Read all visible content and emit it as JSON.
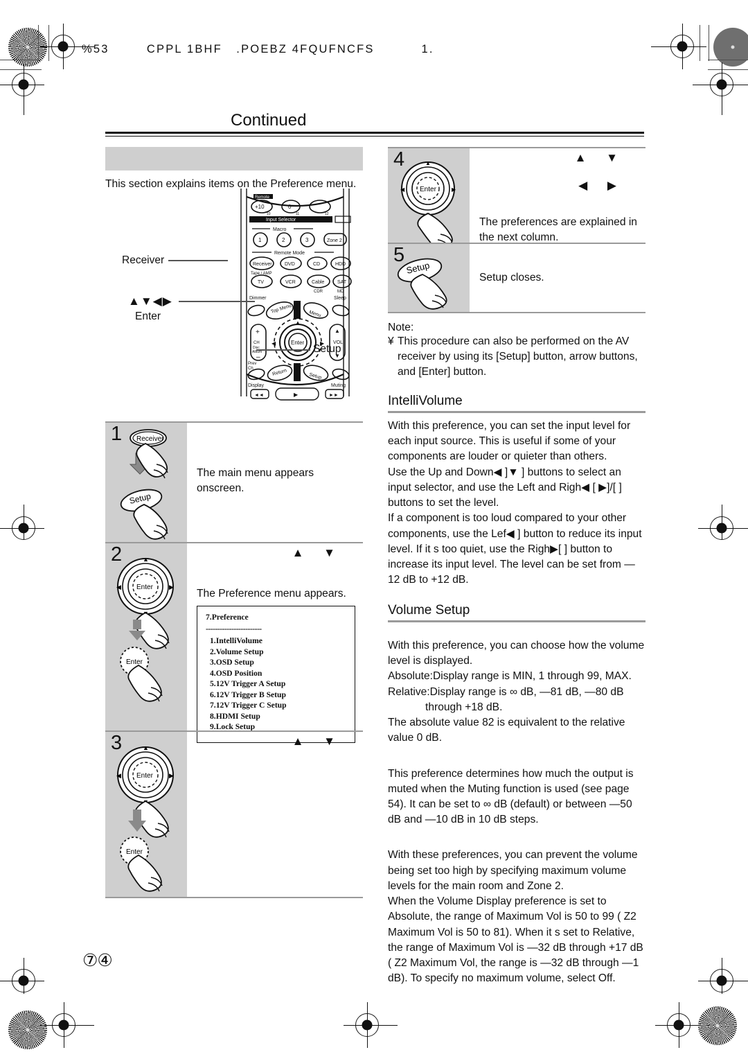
{
  "print_marks": {
    "header_slug": "%53        CPPL 1BHF   .POEBZ 4FQUFNCFS          1."
  },
  "page": {
    "title": "Continued",
    "page_number": "⑦④"
  },
  "left_column": {
    "section_heading_bar": "",
    "intro": "This section explains items on the  Preference  menu.",
    "remote_callouts": {
      "receiver": "Receiver",
      "arrows_glyph": "▲▼◀▶",
      "enter": "Enter",
      "setup": "Setup"
    },
    "remote_buttons": {
      "plus10": "+10",
      "zero": "0",
      "input_selector": "Input Selector",
      "macro": "Macro",
      "macro1": "1",
      "macro2": "2",
      "macro3": "3",
      "zone2": "Zone 2",
      "remote_mode": "Remote Mode",
      "receiver": "Receiver",
      "tape_amp": "Tape / AMP",
      "dvd": "DVD",
      "cd": "CD",
      "hdd": "HDD",
      "tv": "TV",
      "vcr": "VCR",
      "cable": "Cable",
      "cdr": "CDR",
      "sat": "SAT",
      "md": "MD",
      "dimmer": "Dimmer",
      "sleep": "Sleep",
      "top_menu": "Top Menu",
      "menu": "Menu",
      "ch": "CH",
      "disc": "Disc",
      "album": "Album",
      "plus": "+",
      "minus": "–",
      "vol": "VOL",
      "enter": "Enter",
      "prev": "Prev",
      "ch2": "Ch",
      "return": "Return",
      "setup": "Setup",
      "display": "Display",
      "muting": "Muting"
    },
    "steps": [
      {
        "number": "1",
        "buttons": [
          "Receiver",
          "Setup"
        ],
        "text": "The main menu appears onscreen.",
        "arrows": ""
      },
      {
        "number": "2",
        "buttons": [
          "Enter"
        ],
        "text": "The Preference menu appears.",
        "arrows": "▲  ▼"
      },
      {
        "number": "3",
        "buttons": [
          "Enter",
          "Enter"
        ],
        "text": "",
        "arrows": "▲  ▼"
      }
    ],
    "osd_menu": {
      "title": "7.Preference",
      "separator": "------------------------",
      "items": [
        "1.IntelliVolume",
        "2.Volume Setup",
        "3.OSD Setup",
        "4.OSD Position",
        "5.12V Trigger A Setup",
        "6.12V Trigger B Setup",
        "7.12V Trigger C Setup",
        "8.HDMI Setup",
        "9.Lock Setup"
      ]
    }
  },
  "right_column": {
    "steps": [
      {
        "number": "4",
        "buttons": [
          "Enter"
        ],
        "text": "The preferences are explained in the next column.",
        "arrows_up_down": "▲  ▼",
        "arrows_left_right": "◀  ▶"
      },
      {
        "number": "5",
        "buttons": [
          "Setup"
        ],
        "text": "Setup closes.",
        "arrows_up_down": "",
        "arrows_left_right": ""
      }
    ],
    "note": {
      "label": "Note:",
      "bullet": "¥",
      "text": "This procedure can also be performed on the AV receiver by using its [Setup] button, arrow buttons, and [Enter] button."
    },
    "sections": [
      {
        "heading": "IntelliVolume",
        "paragraphs": [
          "With this preference, you can set the input level for each input source. This is useful if some of your components are louder or quieter than others.",
          "Use the Up and Down◀  ]▼  ] buttons to select an input selector, and use the Left and Righ◀ [ ▶]/[   ] buttons to set the level.",
          "If a component is too loud compared to your other components, use the Lef◀   ] button to reduce its input level. If it s too quiet, use the Righ▶[   ] button to increase its input level. The level can be set from —12 dB to +12 dB."
        ]
      },
      {
        "heading": "Volume Setup",
        "paragraphs": [
          "With this preference, you can choose how the volume level is displayed.",
          "Absolute:Display range is MIN, 1 through 99, MAX.",
          "Relative:Display range is ∞ dB, —81 dB, —80 dB",
          "through +18 dB.",
          "The absolute value 82 is equivalent to the relative value 0 dB.",
          "This preference determines how much the output is muted when the Muting function is used (see page 54). It can be set to ∞ dB (default) or between —50 dB and —10 dB in 10 dB steps.",
          "With these preferences, you can prevent the volume being set too high by specifying maximum volume levels for the main room and Zone 2.",
          "When the  Volume Display  preference is set to  Absolute,  the range of  Maximum Vol  is 50 to 99 ( Z2 Maximum Vol  is 50 to 81). When it s set to  Relative,  the range of  Maximum Vol  is —32 dB through +17 dB ( Z2 Maximum Vol,  the range is —32 dB through —1 dB). To specify no maximum volume, select  Off."
        ]
      }
    ]
  }
}
